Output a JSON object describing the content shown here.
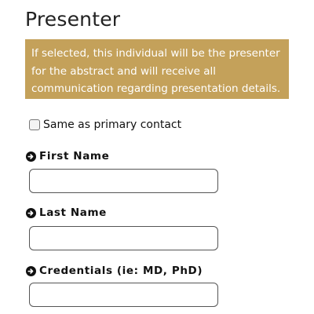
{
  "section": {
    "title": "Presenter",
    "notice": "If selected, this individual will be the presenter for the abstract and will receive all communication regarding presentation details."
  },
  "same_as_primary": {
    "label": "Same as primary contact",
    "checked": false
  },
  "fields": [
    {
      "label": "First Name",
      "value": "",
      "icon": "arrow-circle-right-icon"
    },
    {
      "label": "Last Name",
      "value": "",
      "icon": "arrow-circle-right-icon"
    },
    {
      "label": "Credentials (ie: MD, PhD)",
      "value": "",
      "icon": "arrow-circle-right-icon"
    }
  ],
  "colors": {
    "notice_bg": "#c4a15a",
    "notice_text": "#ffffff"
  }
}
